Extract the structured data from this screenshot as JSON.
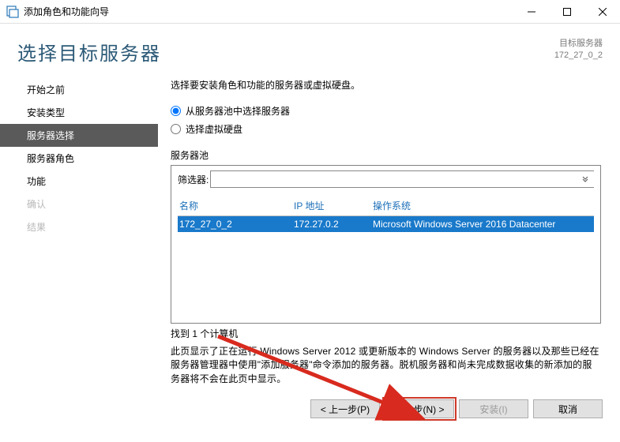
{
  "titlebar": {
    "title": "添加角色和功能向导"
  },
  "header": {
    "heading": "选择目标服务器",
    "dest_label": "目标服务器",
    "dest_value": "172_27_0_2"
  },
  "sidebar": {
    "items": [
      {
        "label": "开始之前"
      },
      {
        "label": "安装类型"
      },
      {
        "label": "服务器选择"
      },
      {
        "label": "服务器角色"
      },
      {
        "label": "功能"
      },
      {
        "label": "确认"
      },
      {
        "label": "结果"
      }
    ]
  },
  "content": {
    "instruction": "选择要安装角色和功能的服务器或虚拟硬盘。",
    "radio1": "从服务器池中选择服务器",
    "radio2": "选择虚拟硬盘",
    "pool_label": "服务器池",
    "filter_label": "筛选器:",
    "filter_value": "",
    "columns": {
      "name": "名称",
      "ip": "IP 地址",
      "os": "操作系统"
    },
    "row": {
      "name": "172_27_0_2",
      "ip": "172.27.0.2",
      "os": "Microsoft Windows Server 2016 Datacenter"
    },
    "found": "找到 1 个计算机",
    "explain": "此页显示了正在运行 Windows Server 2012 或更新版本的 Windows Server 的服务器以及那些已经在服务器管理器中使用\"添加服务器\"命令添加的服务器。脱机服务器和尚未完成数据收集的新添加的服务器将不会在此页中显示。"
  },
  "footer": {
    "prev": "< 上一步(P)",
    "next": "下一步(N) >",
    "install": "安装(I)",
    "cancel": "取消"
  }
}
